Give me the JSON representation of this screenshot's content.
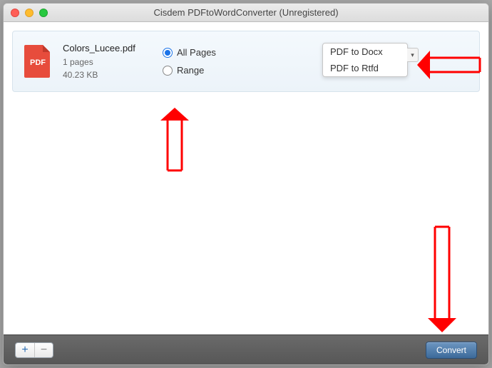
{
  "window": {
    "title": "Cisdem PDFtoWordConverter (Unregistered)"
  },
  "file": {
    "name": "Colors_Lucee.pdf",
    "pages": "1 pages",
    "size": "40.23 KB",
    "icon_label": "PDF"
  },
  "range": {
    "all_label": "All Pages",
    "range_label": "Range"
  },
  "dropdown": {
    "options": [
      "PDF to Docx",
      "PDF to Rtfd"
    ]
  },
  "bottombar": {
    "add_label": "+",
    "remove_label": "−",
    "convert_label": "Convert"
  }
}
